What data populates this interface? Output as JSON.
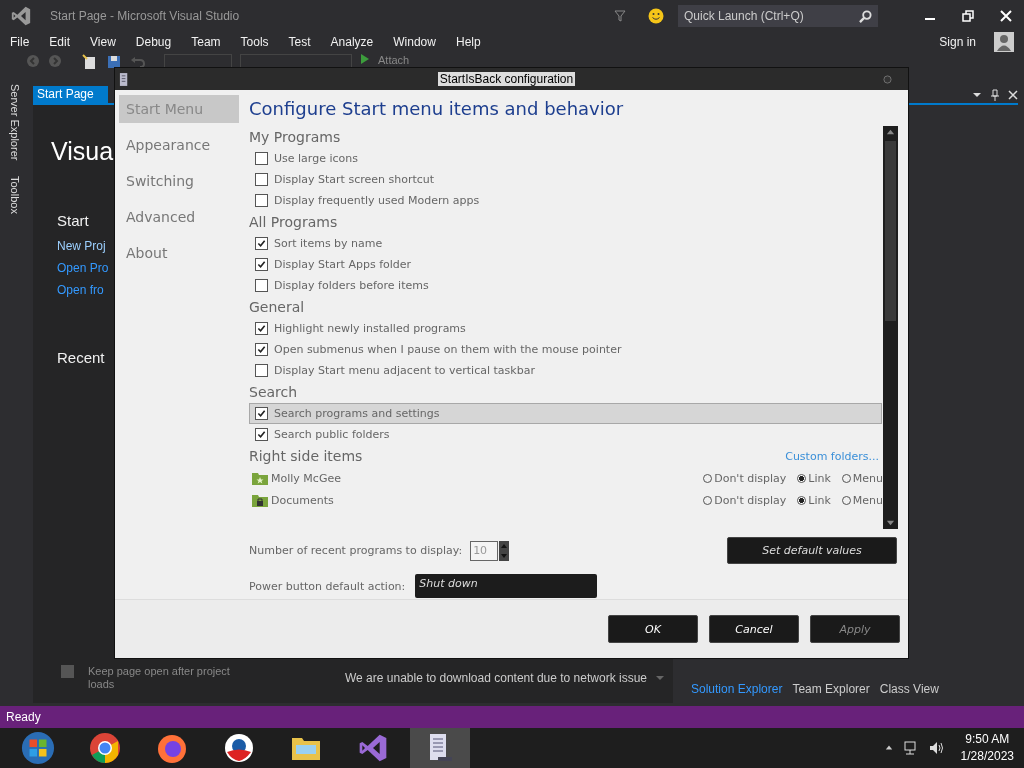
{
  "vs_window": {
    "title": "Start Page - Microsoft Visual Studio",
    "quick_launch": {
      "placeholder": "Quick Launch (Ctrl+Q)"
    },
    "menu": [
      "File",
      "Edit",
      "View",
      "Debug",
      "Team",
      "Tools",
      "Test",
      "Analyze",
      "Window",
      "Help"
    ],
    "sign_in": "Sign in",
    "toolbar": {
      "attach": "Attach"
    },
    "side_tabs": [
      "Server Explorer",
      "Toolbox"
    ],
    "document_tab": {
      "label": "Start Page",
      "selected": true
    },
    "start_page": {
      "heading": "Visua",
      "start_heading": "Start",
      "links": [
        "New Proj",
        "Open Pro",
        "Open fro"
      ],
      "recent_heading": "Recent",
      "keep_open": {
        "label": "Keep page open after project loads",
        "checked": false
      },
      "news_message": "We are unable to download content due to network issue"
    },
    "bottom_tabs": [
      {
        "label": "Solution Explorer",
        "selected": true
      },
      {
        "label": "Team Explorer",
        "selected": false
      },
      {
        "label": "Class View",
        "selected": false
      }
    ],
    "status_bar": "Ready"
  },
  "dialog": {
    "title": "StartIsBack configuration",
    "nav": [
      {
        "label": "Start Menu",
        "selected": true
      },
      {
        "label": "Appearance",
        "selected": false
      },
      {
        "label": "Switching",
        "selected": false
      },
      {
        "label": "Advanced",
        "selected": false
      },
      {
        "label": "About",
        "selected": false
      }
    ],
    "heading": "Configure Start menu items and behavior",
    "sections": [
      {
        "title": "My Programs",
        "items": [
          {
            "label": "Use large icons",
            "checked": false,
            "highlighted": false
          },
          {
            "label": "Display Start screen shortcut",
            "checked": false,
            "highlighted": false
          },
          {
            "label": "Display frequently used Modern apps",
            "checked": false,
            "highlighted": false
          }
        ]
      },
      {
        "title": "All Programs",
        "items": [
          {
            "label": "Sort items by name",
            "checked": true,
            "highlighted": false
          },
          {
            "label": "Display Start Apps folder",
            "checked": true,
            "highlighted": false
          },
          {
            "label": "Display folders before items",
            "checked": false,
            "highlighted": false
          }
        ]
      },
      {
        "title": "General",
        "items": [
          {
            "label": "Highlight newly installed programs",
            "checked": true,
            "highlighted": false
          },
          {
            "label": "Open submenus when I pause on them with the mouse pointer",
            "checked": true,
            "highlighted": false
          },
          {
            "label": "Display Start menu adjacent to vertical taskbar",
            "checked": false,
            "highlighted": false
          }
        ]
      },
      {
        "title": "Search",
        "items": [
          {
            "label": "Search programs and settings",
            "checked": true,
            "highlighted": true
          },
          {
            "label": "Search public folders",
            "checked": true,
            "highlighted": false
          }
        ]
      }
    ],
    "right_side": {
      "title": "Right side items",
      "custom_link": "Custom folders...",
      "items": [
        {
          "name": "Molly McGee",
          "kind": "user",
          "options": [
            {
              "label": "Don't display",
              "selected": false
            },
            {
              "label": "Link",
              "selected": true
            },
            {
              "label": "Menu",
              "selected": false
            }
          ]
        },
        {
          "name": "Documents",
          "kind": "documents",
          "options": [
            {
              "label": "Don't display",
              "selected": false
            },
            {
              "label": "Link",
              "selected": true
            },
            {
              "label": "Menu",
              "selected": false
            }
          ]
        }
      ]
    },
    "recent_programs": {
      "label": "Number of recent programs to display:",
      "value": "10"
    },
    "power_button": {
      "label": "Power button default action:",
      "value": "Shut down"
    },
    "default_button": "Set default values",
    "buttons": [
      {
        "label": "OK",
        "disabled": false
      },
      {
        "label": "Cancel",
        "disabled": false
      },
      {
        "label": "Apply",
        "disabled": true
      }
    ]
  },
  "taskbar": {
    "apps": [
      {
        "kind": "start",
        "selected": false
      },
      {
        "kind": "chrome",
        "selected": false
      },
      {
        "kind": "firefox",
        "selected": false
      },
      {
        "kind": "globe",
        "selected": false
      },
      {
        "kind": "folder",
        "selected": false
      },
      {
        "kind": "vs",
        "selected": false
      },
      {
        "kind": "config",
        "selected": true
      }
    ],
    "time": "9:50 AM",
    "date": "1/28/2023"
  }
}
